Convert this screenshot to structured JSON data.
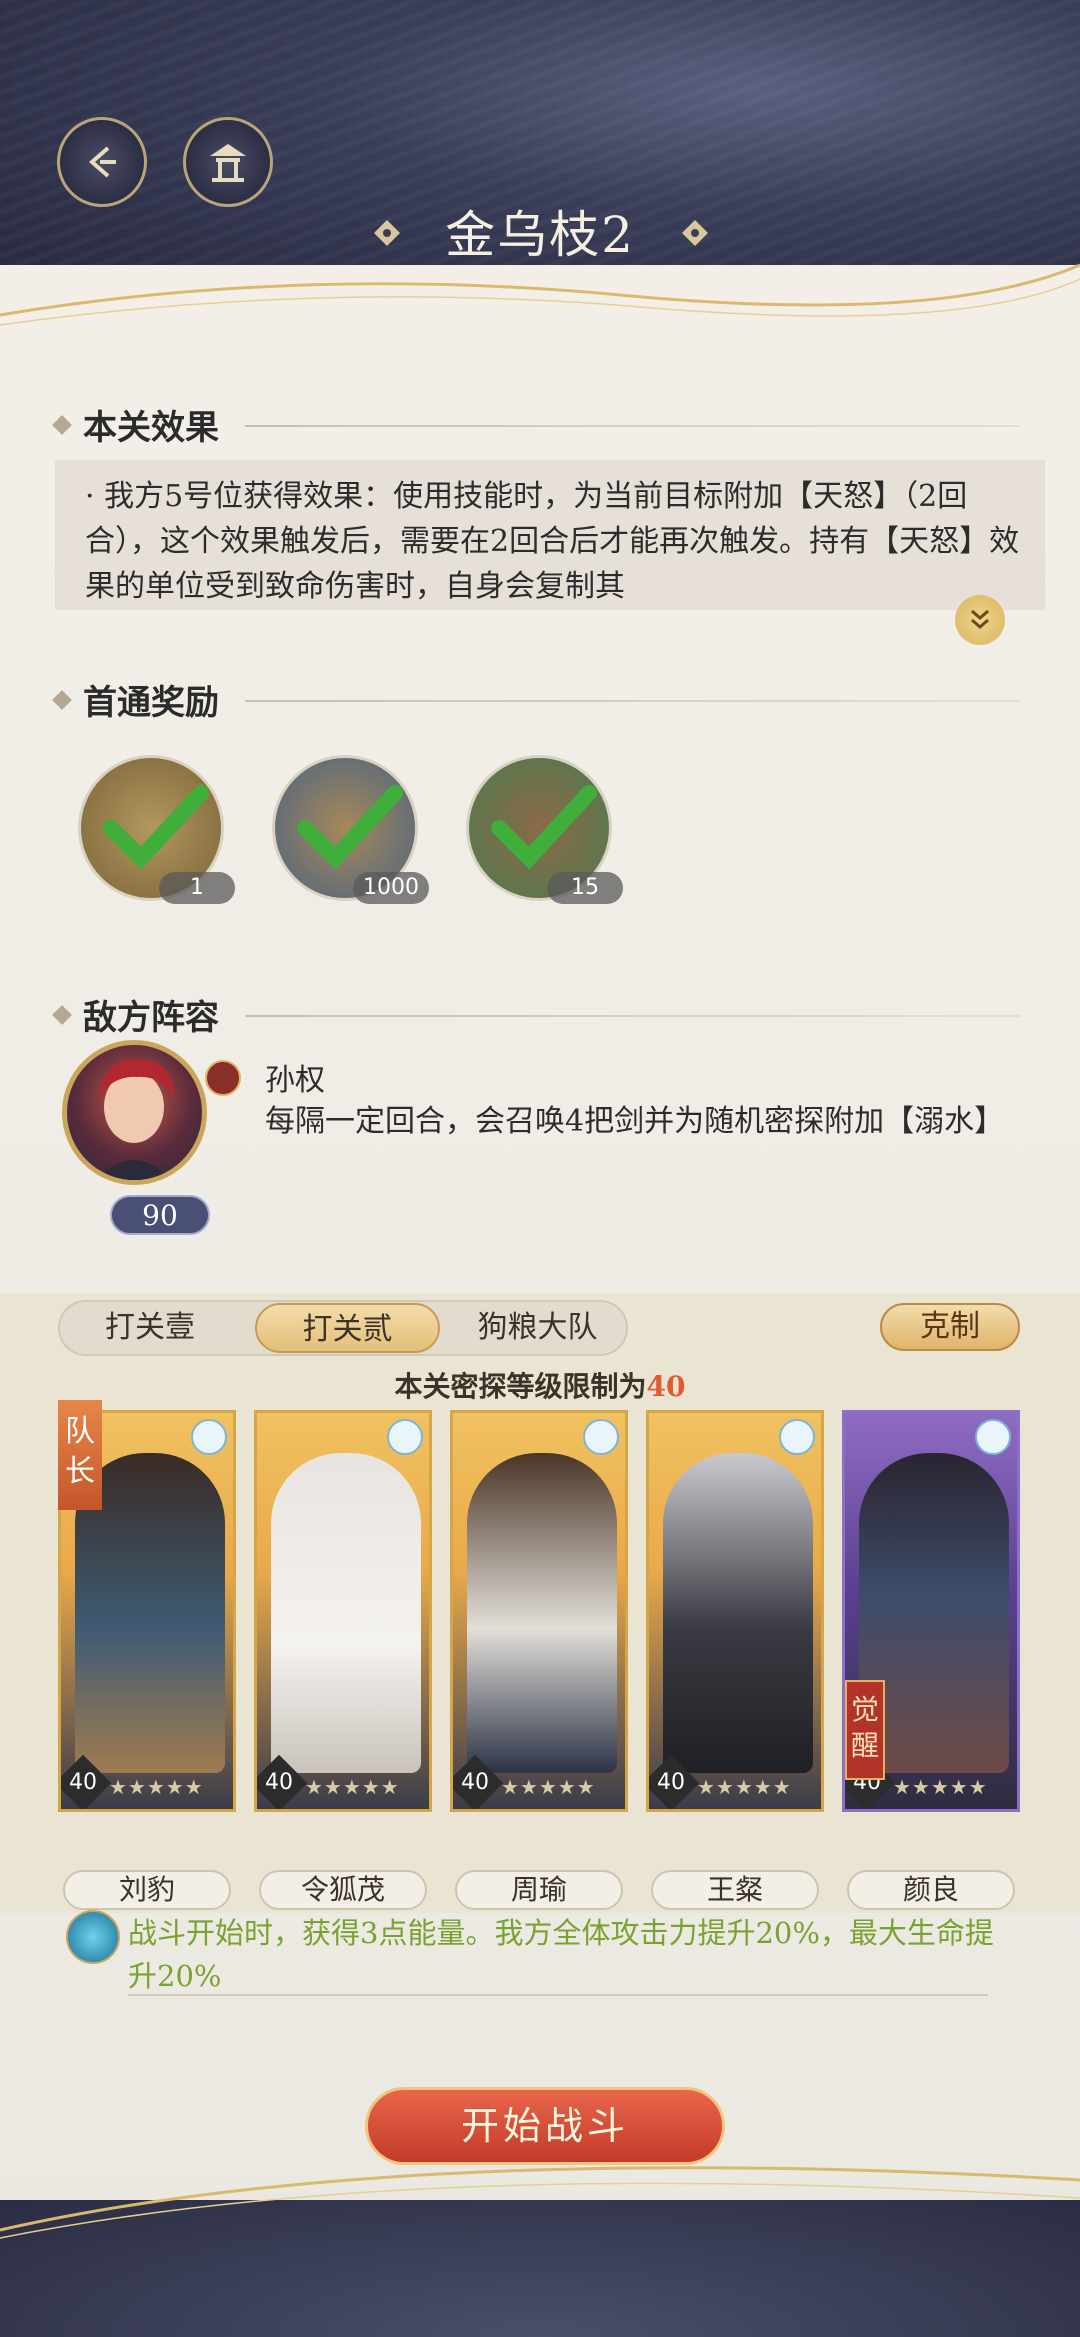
{
  "header": {
    "title": "金乌枝2",
    "back_icon": "back-arrow-icon",
    "home_icon": "pavilion-icon"
  },
  "effect_section": {
    "heading": "本关效果",
    "text": "· 我方5号位获得效果：使用技能时，为当前目标附加【天怒】（2回合），这个效果触发后，需要在2回合后才能再次触发。持有【天怒】效果的单位受到致命伤害时，自身会复制其",
    "expand_icon": "double-chevron-down-icon"
  },
  "reward_section": {
    "heading": "首通奖励",
    "rewards": [
      {
        "count": "1",
        "icon": "token-bag-icon",
        "claimed": true
      },
      {
        "count": "1000",
        "icon": "dragon-coin-icon",
        "claimed": true
      },
      {
        "count": "15",
        "icon": "wine-jar-icon",
        "claimed": true
      }
    ]
  },
  "enemy_section": {
    "heading": "敌方阵容",
    "enemy": {
      "name": "孙权",
      "level": "90",
      "description": "每隔一定回合，会召唤4把剑并为随机密探附加【溺水】"
    }
  },
  "team": {
    "tabs": [
      "打关壹",
      "打关贰",
      "狗粮大队"
    ],
    "active_tab": 1,
    "counter_button": "克制",
    "limit_prefix": "本关密探等级限制为",
    "limit_value": "40",
    "leader_tag": "队长",
    "awake_tag": "觉醒",
    "members": [
      {
        "name": "刘豹",
        "level": "40",
        "stars": "★★★★★",
        "frame": "gold"
      },
      {
        "name": "令狐茂",
        "level": "40",
        "stars": "★★★★★",
        "frame": "gold"
      },
      {
        "name": "周瑜",
        "level": "40",
        "stars": "★★★★★",
        "frame": "gold"
      },
      {
        "name": "王粲",
        "level": "40",
        "stars": "★★★★★",
        "frame": "gold"
      },
      {
        "name": "颜良",
        "level": "40",
        "stars": "★★★★★",
        "frame": "purple"
      }
    ],
    "bonus_text": "战斗开始时，获得3点能量。我方全体攻击力提升20%，最大生命提升20%"
  },
  "start_button": "开始战斗",
  "colors": {
    "accent_gold": "#d4a64a",
    "start_red": "#c23b2a",
    "bonus_green": "#7aa22f",
    "limit_orange": "#e05b2f"
  }
}
